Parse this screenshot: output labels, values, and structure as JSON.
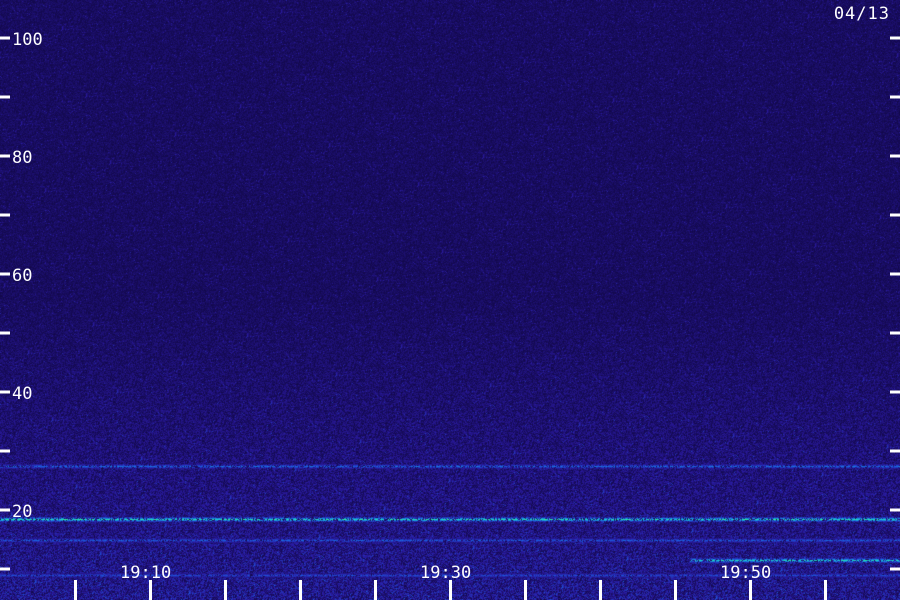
{
  "date_stamp": "04/13",
  "chart_data": {
    "type": "heatmap",
    "title": "",
    "xlabel": "",
    "ylabel": "",
    "x_tick_labels": [
      {
        "label": "19:10",
        "minute": 10
      },
      {
        "label": "19:30",
        "minute": 30
      },
      {
        "label": "19:50",
        "minute": 50
      }
    ],
    "xlim_minutes": [
      0,
      60
    ],
    "x_major_tick_minutes": [
      5,
      10,
      15,
      20,
      25,
      30,
      35,
      40,
      45,
      50,
      55
    ],
    "y_tick_labels": [
      {
        "label": "100",
        "value": 100
      },
      {
        "label": "80",
        "value": 80
      },
      {
        "label": "60",
        "value": 60
      },
      {
        "label": "40",
        "value": 40
      },
      {
        "label": "20",
        "value": 20
      }
    ],
    "y_ticks": [
      100,
      90,
      80,
      70,
      60,
      50,
      40,
      30,
      20,
      10
    ],
    "ylim": [
      5,
      105
    ],
    "grid": false,
    "colormap": [
      "#12084a",
      "#2a1aa0",
      "#1a5be0",
      "#18c8d8",
      "#3cff7a"
    ],
    "bands": [
      {
        "value": 18.5,
        "intensity": 0.95,
        "span_minutes": [
          0,
          60
        ]
      },
      {
        "value": 11.5,
        "intensity": 0.9,
        "span_minutes": [
          46,
          60
        ]
      },
      {
        "value": 27.5,
        "intensity": 0.6,
        "span_minutes": [
          0,
          60
        ]
      },
      {
        "value": 15,
        "intensity": 0.55,
        "span_minutes": [
          0,
          60
        ]
      },
      {
        "value": 9,
        "intensity": 0.5,
        "span_minutes": [
          0,
          60
        ]
      }
    ]
  }
}
